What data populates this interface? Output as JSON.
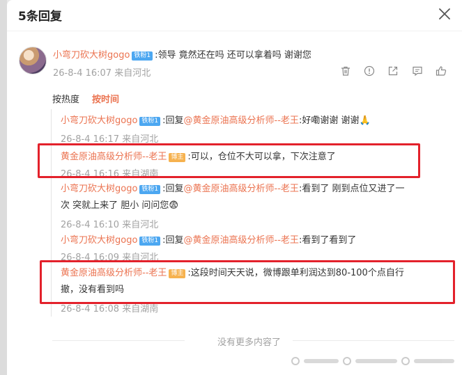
{
  "header": {
    "title": "5条回复"
  },
  "main_comment": {
    "user": "小弯刀砍大树gogo",
    "badge": "铁粉1",
    "text": ":领导 竟然还在吗 还可以拿着吗 谢谢您",
    "meta": "26-8-4 16:07 来自河北"
  },
  "sort_tabs": {
    "hot": "按热度",
    "time": "按时间"
  },
  "replies": [
    {
      "user": "小弯刀砍大树gogo",
      "badge": "铁粉1",
      "prefix": ":回复",
      "mention": "@黄金原油高级分析师--老王",
      "text": ":好嘞谢谢 谢谢🙏",
      "meta": "26-8-4 16:17 来自河北"
    },
    {
      "user": "黄金原油高级分析师--老王",
      "badge": "博主",
      "text": ":可以，仓位不大可以拿，下次注意了",
      "meta": "26-8-4 16:16 来自湖南"
    },
    {
      "user": "小弯刀砍大树gogo",
      "badge": "铁粉1",
      "prefix": ":回复",
      "mention": "@黄金原油高级分析师--老王",
      "text_line1": ":看到了 刚到点位又进了一",
      "text_line2": "次 突就上来了 胆小 问问您😨",
      "meta": "26-8-4 16:10 来自河北"
    },
    {
      "user": "小弯刀砍大树gogo",
      "badge": "铁粉1",
      "prefix": ":回复",
      "mention": "@黄金原油高级分析师--老王",
      "text": ":看到了看到了",
      "meta": "26-8-4 16:09 来自河北"
    },
    {
      "user": "黄金原油高级分析师--老王",
      "badge": "博主",
      "text_line1": ":这段时间天天说，微博跟单利润达到80-100个点自行",
      "text_line2": "撤，没有看到吗",
      "meta": "26-8-4 16:08 来自湖南"
    }
  ],
  "footer": {
    "no_more": "没有更多内容了"
  },
  "colors": {
    "accent": "#eb7350",
    "highlight_box": "#e3212b",
    "fan_badge": "#4ca7f1",
    "blog_badge": "#f6b24f"
  }
}
